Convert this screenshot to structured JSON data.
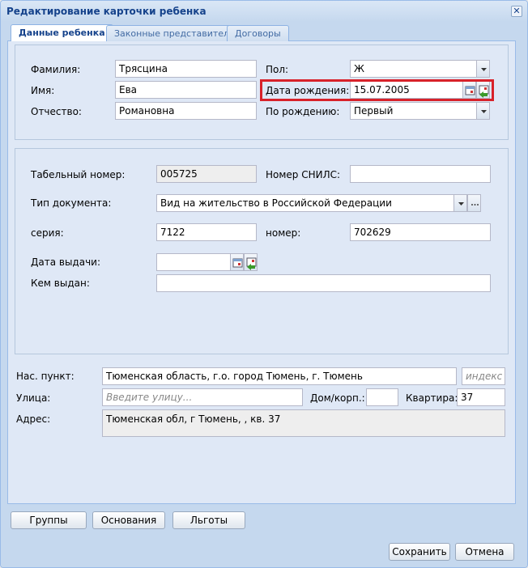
{
  "window": {
    "title": "Редактирование карточки ребенка"
  },
  "tabs": [
    {
      "label": "Данные ребенка"
    },
    {
      "label": "Законные представители"
    },
    {
      "label": "Договоры"
    }
  ],
  "personal": {
    "surname_label": "Фамилия:",
    "surname": "Трясцина",
    "name_label": "Имя:",
    "name": "Ева",
    "patronymic_label": "Отчество:",
    "patronymic": "Романовна",
    "sex_label": "Пол:",
    "sex": "Ж",
    "birthdate_label": "Дата рождения:",
    "birthdate": "15.07.2005",
    "birth_order_label": "По рождению:",
    "birth_order": "Первый"
  },
  "document": {
    "tab_number_label": "Табельный номер:",
    "tab_number": "005725",
    "snils_label": "Номер СНИЛС:",
    "snils": "",
    "doc_type_label": "Тип документа:",
    "doc_type": "Вид на жительство в Российской Федерации",
    "series_label": "серия:",
    "series": "7122",
    "number_label": "номер:",
    "number": "702629",
    "issue_date_label": "Дата выдачи:",
    "issue_date": "",
    "issued_by_label": "Кем выдан:",
    "issued_by": ""
  },
  "address": {
    "locality_label": "Нас. пункт:",
    "locality": "Тюменская область, г.о. город Тюмень, г. Тюмень",
    "index_placeholder": "индекс",
    "street_label": "Улица:",
    "street_placeholder": "Введите улицу...",
    "house_label": "Дом/корп.:",
    "house": "",
    "flat_label": "Квартира:",
    "flat": "37",
    "address_label": "Адрес:",
    "address": "Тюменская обл, г Тюмень, , кв. 37"
  },
  "buttons": {
    "groups": "Группы",
    "bases": "Основания",
    "benefits": "Льготы",
    "save": "Сохранить",
    "cancel": "Отмена"
  },
  "colors": {
    "highlight": "#d8222a",
    "header_text": "#15428b"
  }
}
